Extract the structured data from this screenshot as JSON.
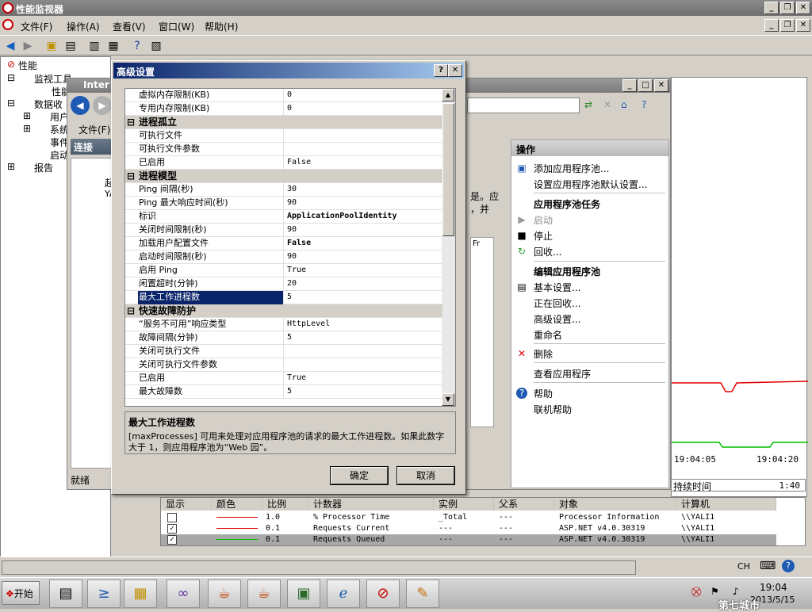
{
  "main_window": {
    "title": "性能监视器"
  },
  "menu": {
    "file": "文件(F)",
    "action": "操作(A)",
    "view": "查看(V)",
    "window": "窗口(W)",
    "help": "帮助(H)"
  },
  "tree": {
    "root": "性能",
    "monitor_tools": "监视工具",
    "perf_monitor": "性能",
    "data_collector": "数据收",
    "user": "用户",
    "system": "系统",
    "event": "事件",
    "startup": "启动",
    "reports": "报告"
  },
  "iis": {
    "title": "Inter",
    "file_menu": "文件(F)",
    "connections": "连接",
    "ready": "就绪",
    "fr": "Fr",
    "trunc1": "起",
    "trunc2": "YA",
    "desc_fragment": "是。应",
    "desc_fragment2": "，并"
  },
  "dialog": {
    "title": "高级设置",
    "help_btn": "?",
    "close_btn": "✕",
    "rows": [
      {
        "key": "虚拟内存限制(KB)",
        "value": "0",
        "type": "prop"
      },
      {
        "key": "专用内存限制(KB)",
        "value": "0",
        "type": "prop"
      },
      {
        "key": "进程孤立",
        "value": "",
        "type": "cat"
      },
      {
        "key": "可执行文件",
        "value": "",
        "type": "prop"
      },
      {
        "key": "可执行文件参数",
        "value": "",
        "type": "prop"
      },
      {
        "key": "已启用",
        "value": "False",
        "type": "prop"
      },
      {
        "key": "进程模型",
        "value": "",
        "type": "cat"
      },
      {
        "key": "Ping 间隔(秒)",
        "value": "30",
        "type": "prop"
      },
      {
        "key": "Ping 最大响应时间(秒)",
        "value": "90",
        "type": "prop"
      },
      {
        "key": "标识",
        "value": "ApplicationPoolIdentity",
        "type": "bold"
      },
      {
        "key": "关闭时间限制(秒)",
        "value": "90",
        "type": "prop"
      },
      {
        "key": "加载用户配置文件",
        "value": "False",
        "type": "bold"
      },
      {
        "key": "启动时间限制(秒)",
        "value": "90",
        "type": "prop"
      },
      {
        "key": "启用 Ping",
        "value": "True",
        "type": "prop"
      },
      {
        "key": "闲置超时(分钟)",
        "value": "20",
        "type": "prop"
      },
      {
        "key": "最大工作进程数",
        "value": "5",
        "type": "sel"
      },
      {
        "key": "快速故障防护",
        "value": "",
        "type": "cat"
      },
      {
        "key": "“服务不可用”响应类型",
        "value": "HttpLevel",
        "type": "prop"
      },
      {
        "key": "故障间隔(分钟)",
        "value": "5",
        "type": "prop"
      },
      {
        "key": "关闭可执行文件",
        "value": "",
        "type": "prop"
      },
      {
        "key": "关闭可执行文件参数",
        "value": "",
        "type": "prop"
      },
      {
        "key": "已启用",
        "value": "True",
        "type": "prop"
      },
      {
        "key": "最大故障数",
        "value": "5",
        "type": "prop"
      }
    ],
    "desc_title": "最大工作进程数",
    "desc_text": "[maxProcesses] 可用来处理对应用程序池的请求的最大工作进程数。如果此数字大于 1，则应用程序池为“Web 园”。",
    "ok": "确定",
    "cancel": "取消"
  },
  "actions": {
    "header": "操作",
    "add_pool": "添加应用程序池...",
    "set_defaults": "设置应用程序池默认设置...",
    "pool_tasks": "应用程序池任务",
    "start": "启动",
    "stop": "停止",
    "recycle": "回收...",
    "edit_pool": "编辑应用程序池",
    "basic": "基本设置...",
    "recycling": "正在回收...",
    "advanced": "高级设置...",
    "rename": "重命名",
    "delete": "删除",
    "view_apps": "查看应用程序",
    "help": "帮助",
    "online_help": "联机帮助"
  },
  "graph": {
    "t1": "19:04:05",
    "t2": "19:04:20",
    "duration_label": "持续时间",
    "duration": "1:40"
  },
  "legend": {
    "headers": [
      "显示",
      "颜色",
      "比例",
      "计数器",
      "实例",
      "父系",
      "对象",
      "计算机"
    ],
    "rows": [
      {
        "show": "",
        "scale": "1.0",
        "counter": "% Processor Time",
        "instance": "_Total",
        "parent": "---",
        "object": "Processor Information",
        "computer": "\\\\YALI1",
        "color": "#e00000"
      },
      {
        "show": "✓",
        "scale": "0.1",
        "counter": "Requests Current",
        "instance": "---",
        "parent": "---",
        "object": "ASP.NET v4.0.30319",
        "computer": "\\\\YALI1",
        "color": "#e00000"
      },
      {
        "show": "✓",
        "scale": "0.1",
        "counter": "Requests Queued",
        "instance": "---",
        "parent": "---",
        "object": "ASP.NET v4.0.30319",
        "computer": "\\\\YALI1",
        "color": "#00c000"
      }
    ]
  },
  "taskbar": {
    "start": "开始",
    "ime": "CH",
    "time": "19:04",
    "date": "2013/5/15",
    "watermark": "第七城市"
  }
}
